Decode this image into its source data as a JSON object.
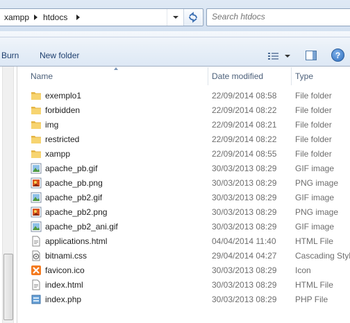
{
  "address_bar": {
    "crumbs": [
      "xampp",
      "htdocs"
    ],
    "search_placeholder": "Search htdocs"
  },
  "toolbar": {
    "burn_label": "Burn",
    "new_folder_label": "New folder"
  },
  "columns": {
    "name": "Name",
    "date": "Date modified",
    "type": "Type"
  },
  "files": [
    {
      "name": "exemplo1",
      "date": "22/09/2014 08:58",
      "type": "File folder",
      "icon": "folder-icon"
    },
    {
      "name": "forbidden",
      "date": "22/09/2014 08:22",
      "type": "File folder",
      "icon": "folder-icon"
    },
    {
      "name": "img",
      "date": "22/09/2014 08:21",
      "type": "File folder",
      "icon": "folder-icon"
    },
    {
      "name": "restricted",
      "date": "22/09/2014 08:22",
      "type": "File folder",
      "icon": "folder-icon"
    },
    {
      "name": "xampp",
      "date": "22/09/2014 08:55",
      "type": "File folder",
      "icon": "folder-icon"
    },
    {
      "name": "apache_pb.gif",
      "date": "30/03/2013 08:29",
      "type": "GIF image",
      "icon": "gif-image-icon"
    },
    {
      "name": "apache_pb.png",
      "date": "30/03/2013 08:29",
      "type": "PNG image",
      "icon": "png-image-icon"
    },
    {
      "name": "apache_pb2.gif",
      "date": "30/03/2013 08:29",
      "type": "GIF image",
      "icon": "gif-image-icon"
    },
    {
      "name": "apache_pb2.png",
      "date": "30/03/2013 08:29",
      "type": "PNG image",
      "icon": "png-image-icon"
    },
    {
      "name": "apache_pb2_ani.gif",
      "date": "30/03/2013 08:29",
      "type": "GIF image",
      "icon": "gif-image-icon"
    },
    {
      "name": "applications.html",
      "date": "04/04/2014 11:40",
      "type": "HTML File",
      "icon": "html-file-icon"
    },
    {
      "name": "bitnami.css",
      "date": "29/04/2014 04:27",
      "type": "Cascading Style",
      "icon": "css-file-icon"
    },
    {
      "name": "favicon.ico",
      "date": "30/03/2013 08:29",
      "type": "Icon",
      "icon": "xampp-ico-icon"
    },
    {
      "name": "index.html",
      "date": "30/03/2013 08:29",
      "type": "HTML File",
      "icon": "html-file-icon"
    },
    {
      "name": "index.php",
      "date": "30/03/2013 08:29",
      "type": "PHP File",
      "icon": "php-file-icon"
    }
  ],
  "colors": {
    "toolbar_text": "#1e3f6e",
    "header_text": "#4c607a",
    "folder": "#f2c75c"
  }
}
